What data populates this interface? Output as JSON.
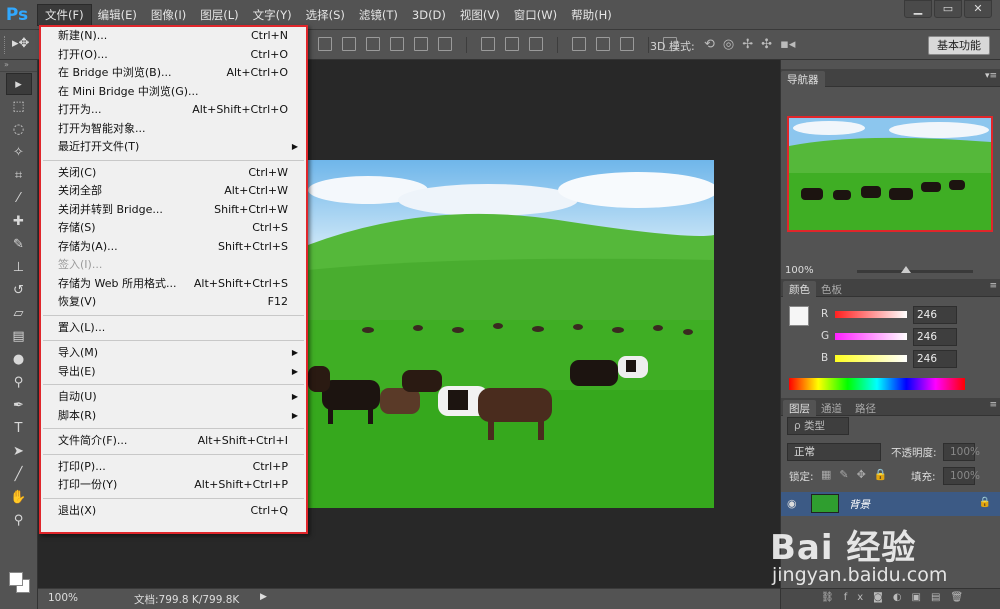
{
  "app": {
    "logo": "Ps"
  },
  "menubar": {
    "items": [
      "文件(F)",
      "编辑(E)",
      "图像(I)",
      "图层(L)",
      "文字(Y)",
      "选择(S)",
      "滤镜(T)",
      "3D(D)",
      "视图(V)",
      "窗口(W)",
      "帮助(H)"
    ],
    "active_index": 0
  },
  "window_buttons": [
    "▁",
    "▭",
    "✕"
  ],
  "optionsbar": {
    "mode_3d_label": "3D 模式:",
    "workspace_button": "基本功能"
  },
  "file_menu": {
    "items": [
      {
        "label": "新建(N)...",
        "shortcut": "Ctrl+N"
      },
      {
        "label": "打开(O)...",
        "shortcut": "Ctrl+O"
      },
      {
        "label": "在 Bridge 中浏览(B)...",
        "shortcut": "Alt+Ctrl+O"
      },
      {
        "label": "在 Mini Bridge 中浏览(G)...",
        "shortcut": ""
      },
      {
        "label": "打开为...",
        "shortcut": "Alt+Shift+Ctrl+O"
      },
      {
        "label": "打开为智能对象...",
        "shortcut": ""
      },
      {
        "label": "最近打开文件(T)",
        "shortcut": "",
        "submenu": true
      },
      {
        "separator": true
      },
      {
        "label": "关闭(C)",
        "shortcut": "Ctrl+W"
      },
      {
        "label": "关闭全部",
        "shortcut": "Alt+Ctrl+W"
      },
      {
        "label": "关闭并转到 Bridge...",
        "shortcut": "Shift+Ctrl+W"
      },
      {
        "label": "存储(S)",
        "shortcut": "Ctrl+S"
      },
      {
        "label": "存储为(A)...",
        "shortcut": "Shift+Ctrl+S"
      },
      {
        "label": "签入(I)...",
        "shortcut": "",
        "disabled": true
      },
      {
        "label": "存储为 Web 所用格式...",
        "shortcut": "Alt+Shift+Ctrl+S"
      },
      {
        "label": "恢复(V)",
        "shortcut": "F12"
      },
      {
        "separator": true
      },
      {
        "label": "置入(L)...",
        "shortcut": ""
      },
      {
        "separator": true
      },
      {
        "label": "导入(M)",
        "shortcut": "",
        "submenu": true
      },
      {
        "label": "导出(E)",
        "shortcut": "",
        "submenu": true
      },
      {
        "separator": true
      },
      {
        "label": "自动(U)",
        "shortcut": "",
        "submenu": true
      },
      {
        "label": "脚本(R)",
        "shortcut": "",
        "submenu": true
      },
      {
        "separator": true
      },
      {
        "label": "文件简介(F)...",
        "shortcut": "Alt+Shift+Ctrl+I"
      },
      {
        "separator": true
      },
      {
        "label": "打印(P)...",
        "shortcut": "Ctrl+P"
      },
      {
        "label": "打印一份(Y)",
        "shortcut": "Alt+Shift+Ctrl+P"
      },
      {
        "separator": true
      },
      {
        "label": "退出(X)",
        "shortcut": "Ctrl+Q"
      }
    ]
  },
  "statusbar": {
    "zoom": "100%",
    "doc_info": "文档:799.8 K/799.8K"
  },
  "navigator": {
    "tab": "导航器",
    "zoom": "100%"
  },
  "color_panel": {
    "tabs": [
      "颜色",
      "色板"
    ],
    "channels": [
      {
        "label": "R",
        "value": "246",
        "color": "#ff2020"
      },
      {
        "label": "G",
        "value": "246",
        "color": "#ff20ff"
      },
      {
        "label": "B",
        "value": "246",
        "color": "#ffff20"
      }
    ]
  },
  "layers_panel": {
    "tabs": [
      "图层",
      "通道",
      "路径"
    ],
    "filter_label": "ρ 类型",
    "blend_mode": "正常",
    "opacity_label": "不透明度:",
    "opacity_value": "100%",
    "lock_label": "锁定:",
    "fill_label": "填充:",
    "fill_value": "100%",
    "layer_name": "背景"
  },
  "watermark": {
    "logo": "Bai 经验",
    "url": "jingyan.baidu.com"
  },
  "colors": {
    "accent_red": "#e0262b",
    "ps_blue": "#31a8ff",
    "selected_layer": "#3c5a85"
  }
}
